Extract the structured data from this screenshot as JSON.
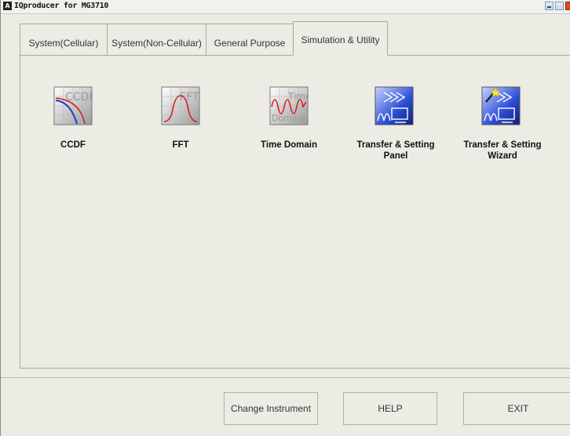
{
  "window": {
    "title": "IQproducer for MG3710",
    "app_icon_letter": "A"
  },
  "tabs": [
    {
      "label": "System(Cellular)"
    },
    {
      "label": "System(Non-Cellular)"
    },
    {
      "label": "General Purpose"
    },
    {
      "label": "Simulation & Utility",
      "active": true
    }
  ],
  "tools": [
    {
      "line1": "CCDF",
      "line2": "",
      "icon": "ccdf-icon",
      "icon_text": "CCDF"
    },
    {
      "line1": "FFT",
      "line2": "",
      "icon": "fft-icon",
      "icon_text": "FFT"
    },
    {
      "line1": "Time Domain",
      "line2": "",
      "icon": "time-domain-icon",
      "icon_text_top": "Time",
      "icon_text_bottom": "Domain"
    },
    {
      "line1": "Transfer & Setting",
      "line2": "Panel",
      "icon": "transfer-setting-panel-icon"
    },
    {
      "line1": "Transfer & Setting",
      "line2": "Wizard",
      "icon": "transfer-setting-wizard-icon"
    }
  ],
  "buttons": {
    "change_instrument": "Change Instrument",
    "help": "HELP",
    "exit": "EXIT"
  },
  "colors": {
    "background": "#ecebe4",
    "icon_blue": "#1d3fc4",
    "curve_red": "#d42020"
  }
}
